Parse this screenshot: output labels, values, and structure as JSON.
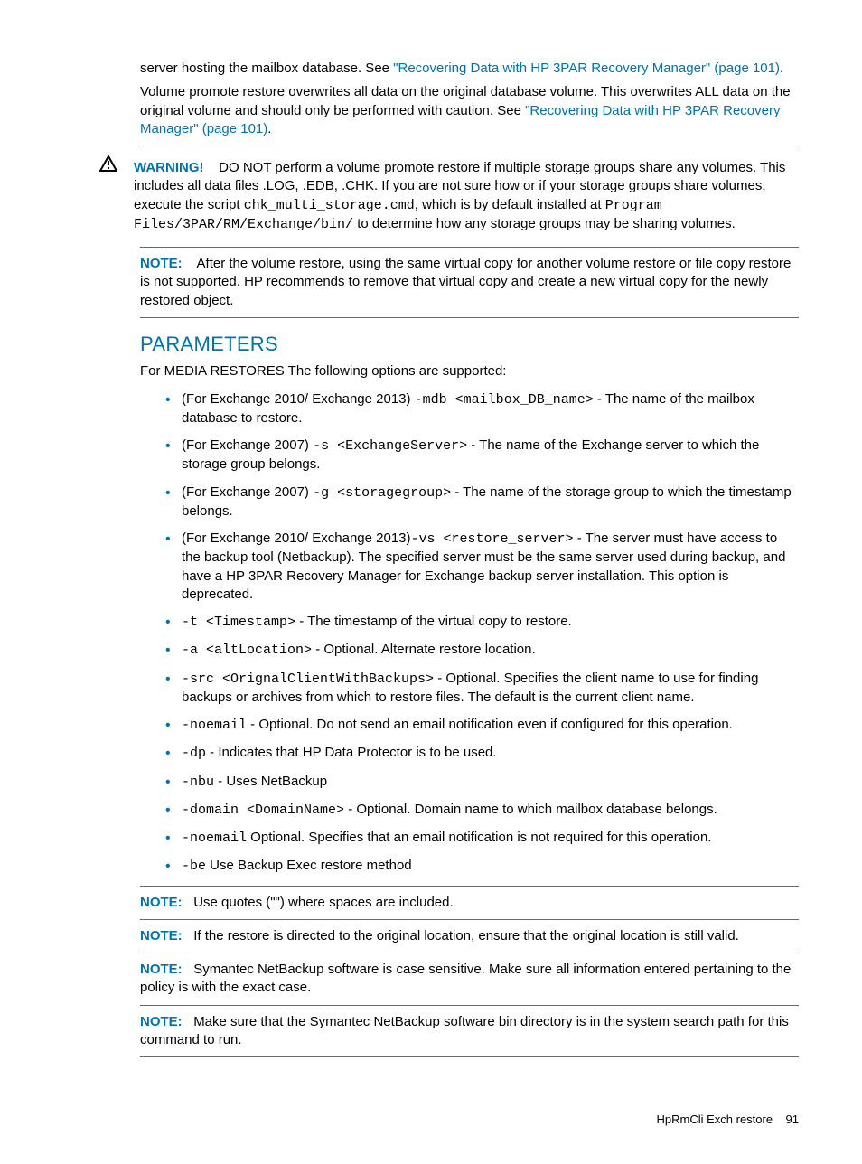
{
  "intro": {
    "p1_a": "server hosting the mailbox database. See ",
    "p1_link": "\"Recovering Data with HP 3PAR Recovery Manager\" (page 101)",
    "p1_b": ".",
    "p2_a": "Volume promote restore overwrites all data on the original database volume. This overwrites ALL data on the original volume and should only be performed with caution. See ",
    "p2_link": "\"Recovering Data with HP 3PAR Recovery Manager\" (page 101)",
    "p2_b": "."
  },
  "warning": {
    "label": "WARNING!",
    "t1": "DO NOT perform a volume promote restore if multiple storage groups share any volumes. This includes all data files .LOG, .EDB, .CHK. If you are not sure how or if your storage groups share volumes, execute the script ",
    "code1": "chk_multi_storage.cmd",
    "t2": ", which is by default installed at ",
    "code2": "Program Files/3PAR/RM/Exchange/bin/",
    "t3": " to determine how any storage groups may be sharing volumes."
  },
  "note_top": {
    "label": "NOTE:",
    "text": "After the volume restore, using the same virtual copy for another volume restore or file copy restore is not supported. HP recommends to remove that virtual copy and create a new virtual copy for the newly restored object."
  },
  "params": {
    "heading": "PARAMETERS",
    "lead": "For MEDIA RESTORES The following options are supported:",
    "items": [
      {
        "prefix": "(For Exchange 2010/ Exchange 2013) ",
        "code": "-mdb <mailbox_DB_name>",
        "suffix": " - The name of the mailbox database to restore."
      },
      {
        "prefix": "(For Exchange 2007) ",
        "code": "-s <ExchangeServer>",
        "suffix": " - The name of the Exchange server to which the storage group belongs."
      },
      {
        "prefix": "(For Exchange 2007) ",
        "code": "-g <storagegroup>",
        "suffix": " - The name of the storage group to which the timestamp belongs."
      },
      {
        "prefix": "(For Exchange 2010/ Exchange 2013)",
        "code": "-vs <restore_server>",
        "suffix": " - The server must have access to the backup tool (Netbackup). The specified server must be the same server used during backup, and have a HP 3PAR Recovery Manager for Exchange backup server installation. This option is deprecated."
      },
      {
        "prefix": "",
        "code": "-t <Timestamp>",
        "suffix": " - The timestamp of the virtual copy to restore."
      },
      {
        "prefix": "",
        "code": "-a <altLocation>",
        "suffix": " - Optional. Alternate restore location."
      },
      {
        "prefix": "",
        "code": "-src <OrignalClientWithBackups>",
        "suffix": " - Optional. Specifies the client name to use for finding backups or archives from which to restore files. The default is the current client name."
      },
      {
        "prefix": "",
        "code": "-noemail",
        "suffix": " - Optional. Do not send an email notification even if configured for this operation."
      },
      {
        "prefix": "",
        "code": "-dp",
        "suffix": " - Indicates that HP Data Protector is to be used."
      },
      {
        "prefix": "",
        "code": "-nbu",
        "suffix": " - Uses NetBackup"
      },
      {
        "prefix": "",
        "code": "-domain <DomainName>",
        "suffix": " - Optional. Domain name to which mailbox database belongs."
      },
      {
        "prefix": "",
        "code": "-noemail",
        "suffix": " Optional. Specifies that an email notification is not required for this operation."
      },
      {
        "prefix": "",
        "code": "-be",
        "suffix": " Use Backup Exec restore method"
      }
    ]
  },
  "notes": [
    {
      "label": "NOTE:",
      "text": "Use quotes (\"\") where spaces are included."
    },
    {
      "label": "NOTE:",
      "text": "If the restore is directed to the original location, ensure that the original location is still valid."
    },
    {
      "label": "NOTE:",
      "text": "Symantec NetBackup software is case sensitive. Make sure all information entered pertaining to the policy is with the exact case."
    },
    {
      "label": "NOTE:",
      "text": "Make sure that the Symantec NetBackup software bin directory is in the system search path for this command to run."
    }
  ],
  "footer": {
    "left": "HpRmCli Exch restore",
    "page": "91"
  }
}
